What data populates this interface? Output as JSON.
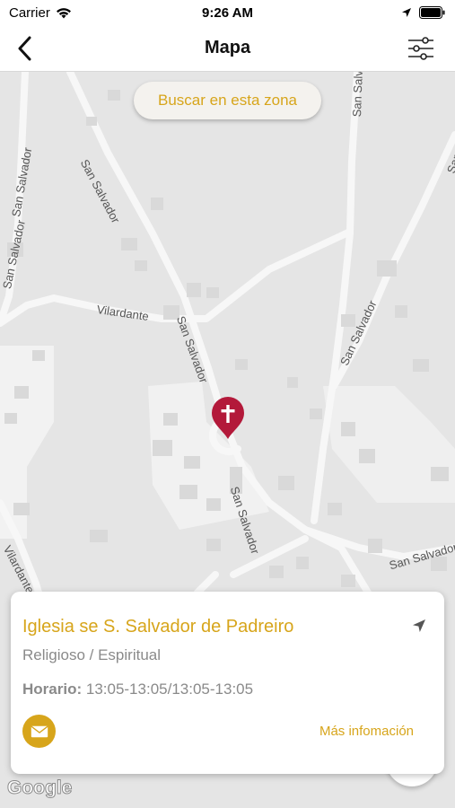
{
  "status_bar": {
    "carrier": "Carrier",
    "time": "9:26 AM"
  },
  "nav": {
    "title": "Mapa"
  },
  "map": {
    "search_zone_label": "Buscar en esta zona",
    "street_labels": [
      "San Salvador",
      "San Salvador",
      "San Salvador",
      "San Salvador",
      "San Salvador",
      "San Salvador",
      "San Salvador",
      "San Salvador",
      "Vilardante",
      "Vilardante",
      "San Salvador"
    ],
    "attribution": "Google"
  },
  "place_card": {
    "title": "Iglesia se S. Salvador de Padreiro",
    "category": "Religioso / Espiritual",
    "schedule_label": "Horario:",
    "schedule_value": "13:05-13:05/13:05-13:05",
    "more_info_label": "Más infomación"
  },
  "colors": {
    "accent": "#d7a51b",
    "pin": "#b3193a"
  },
  "icons": {
    "back": "chevron-left-icon",
    "filter": "sliders-icon",
    "navigate": "navigation-arrow-icon",
    "mail": "envelope-icon",
    "pin": "church-cross-pin-icon"
  }
}
